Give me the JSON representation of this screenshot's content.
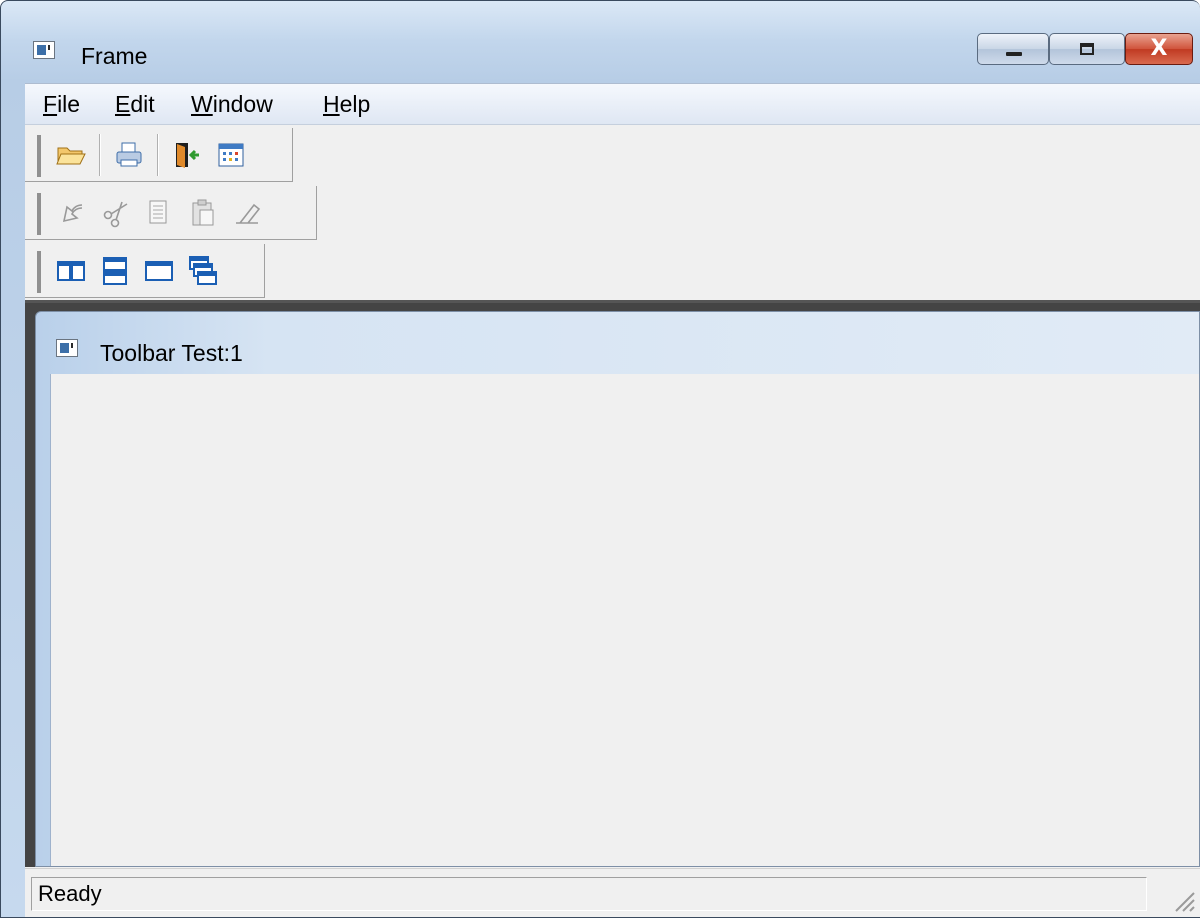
{
  "window": {
    "title": "Frame",
    "controls": {
      "minimize": "minimize",
      "maximize": "maximize",
      "close": "X"
    }
  },
  "menu": {
    "items": [
      {
        "label": "File",
        "mnemonic": "F"
      },
      {
        "label": "Edit",
        "mnemonic": "E"
      },
      {
        "label": "Window",
        "mnemonic": "W"
      },
      {
        "label": "Help",
        "mnemonic": "H"
      }
    ]
  },
  "toolbars": {
    "file": [
      "open-folder-icon",
      "print-icon",
      "exit-door-icon",
      "calendar-grid-icon"
    ],
    "edit": [
      "undo-icon",
      "cut-icon",
      "copy-icon",
      "paste-icon",
      "erase-icon"
    ],
    "window": [
      "tile-vertical-icon",
      "tile-horizontal-icon",
      "maximize-window-icon",
      "cascade-windows-icon"
    ],
    "edit_enabled": false
  },
  "child_window": {
    "title": "Toolbar Test:1"
  },
  "status": {
    "text": "Ready"
  },
  "colors": {
    "accent": "#1b5fb4",
    "client_background": "#f0f0f0",
    "close_button": "#c9452d"
  }
}
